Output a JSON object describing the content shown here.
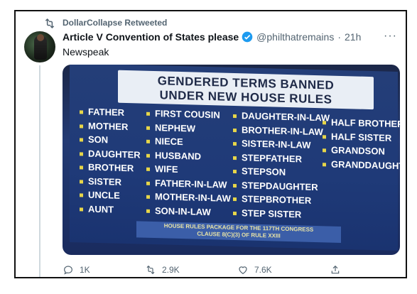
{
  "retweet": {
    "label": "DollarCollapse Retweeted"
  },
  "tweet": {
    "author_name": "Article V Convention of States please",
    "handle": "@philthatremains",
    "time": "21h",
    "text": "Newspeak",
    "more": "···"
  },
  "media": {
    "headline_line1": "GENDERED TERMS BANNED",
    "headline_line2": "UNDER NEW HOUSE RULES",
    "columns": [
      [
        "FATHER",
        "MOTHER",
        "SON",
        "DAUGHTER",
        "BROTHER",
        "SISTER",
        "UNCLE",
        "AUNT"
      ],
      [
        "FIRST COUSIN",
        "NEPHEW",
        "NIECE",
        "HUSBAND",
        "WIFE",
        "FATHER-IN-LAW",
        "MOTHER-IN-LAW",
        "SON-IN-LAW"
      ],
      [
        "DAUGHTER-IN-LAW",
        "BROTHER-IN-LAW",
        "SISTER-IN-LAW",
        "STEPFATHER",
        "STEPSON",
        "STEPDAUGHTER",
        "STEPBROTHER",
        "STEP SISTER"
      ],
      [
        "HALF BROTHER",
        "HALF SISTER",
        "GRANDSON",
        "GRANDDAUGHTER"
      ]
    ],
    "footer_line1": "HOUSE RULES PACKAGE FOR THE 117TH CONGRESS",
    "footer_line2": "CLAUSE 8(C)(3) OF RULE XXIII"
  },
  "actions": {
    "reply_count": "1K",
    "retweet_count": "2.9K",
    "like_count": "7.6K"
  },
  "colors": {
    "accent": "#1d9bf0",
    "muted": "#536471",
    "bullet": "#e7d649"
  }
}
